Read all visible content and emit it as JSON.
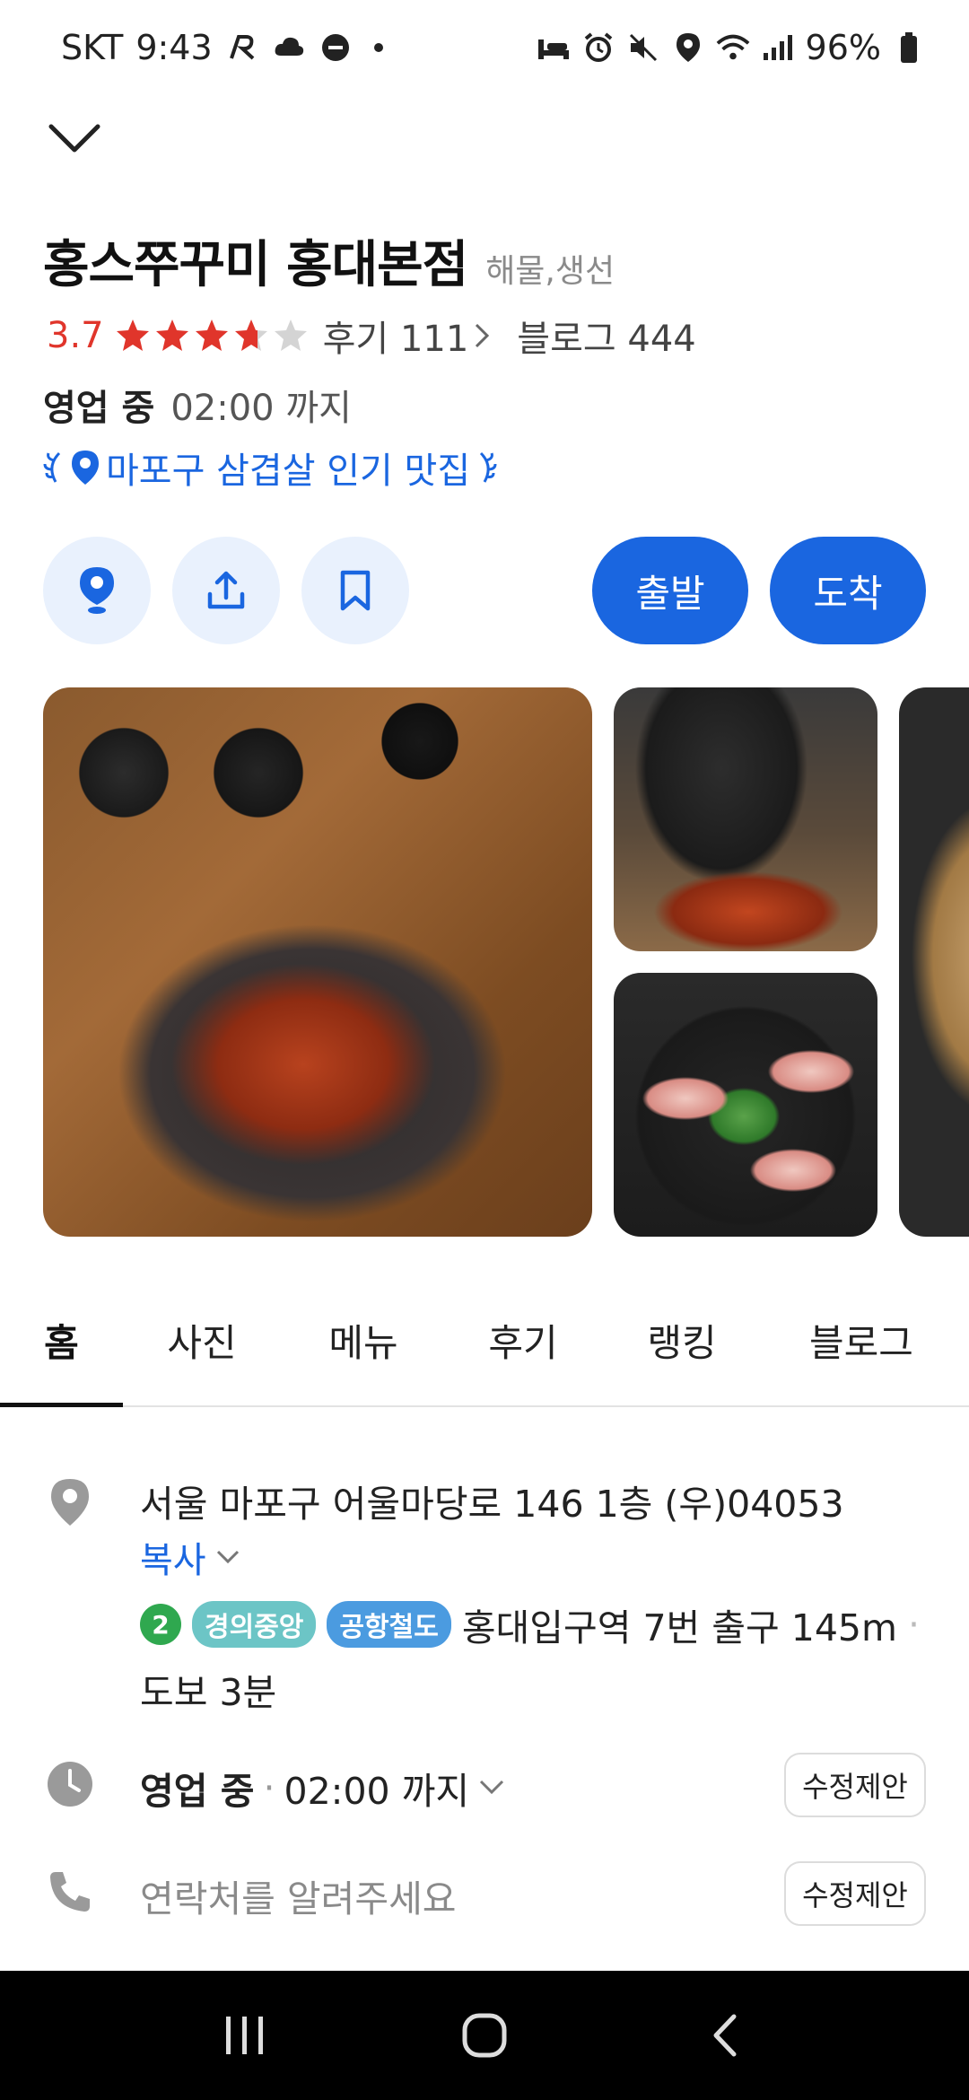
{
  "status_bar": {
    "carrier": "SKT",
    "time": "9:43",
    "battery": "96%"
  },
  "place": {
    "name": "홍스쭈꾸미 홍대본점",
    "category": "해물,생선",
    "rating": "3.7",
    "rating_value": 3.7,
    "review_label": "후기 111",
    "blog_label": "블로그 444",
    "status_open": "영업 중",
    "close_time": "02:00 까지",
    "award": "마포구 삼겹살 인기 맛집"
  },
  "actions": {
    "depart": "출발",
    "arrive": "도착"
  },
  "tabs": [
    "홈",
    "사진",
    "메뉴",
    "후기",
    "랭킹",
    "블로그"
  ],
  "info": {
    "address": "서울 마포구 어울마당로 146 1층 (우)04053",
    "copy": "복사",
    "subway_line": "2",
    "line_tag_1": "경의중앙",
    "line_tag_2": "공항철도",
    "station": "홍대입구역 7번 출구 145m",
    "walk": "도보 3분",
    "hours_open": "영업 중",
    "hours_until": "02:00 까지",
    "phone_placeholder": "연락처를 알려주세요",
    "suggest_label": "수정제안"
  },
  "colors": {
    "accent": "#1a66e0",
    "rating": "#e0352b",
    "line2": "#2fa84f"
  }
}
